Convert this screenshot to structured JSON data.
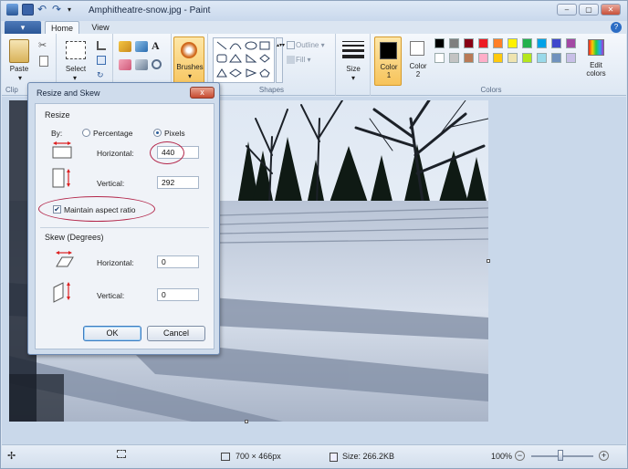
{
  "window": {
    "title": "Amphitheatre-snow.jpg - Paint",
    "help_label": "?"
  },
  "tabs": {
    "file_label": "▾",
    "home_label": "Home",
    "view_label": "View"
  },
  "ribbon": {
    "clipboard": {
      "paste_label": "Paste",
      "group_label": "Clip"
    },
    "image": {
      "select_label": "Select"
    },
    "tools": {
      "brushes_label": "Brushes"
    },
    "shapes": {
      "outline_label": "Outline ▾",
      "fill_label": "Fill ▾",
      "group_label": "Shapes"
    },
    "size": {
      "label": "Size"
    },
    "colors": {
      "color1_label": "Color\n1",
      "color2_label": "Color\n2",
      "edit_label": "Edit\ncolors",
      "group_label": "Colors",
      "color1_value": "#000000",
      "color2_value": "#ffffff",
      "palette_row1": [
        "#000000",
        "#7f7f7f",
        "#880015",
        "#ed1c24",
        "#ff7f27",
        "#fff200",
        "#22b14c",
        "#00a2e8",
        "#3f48cc",
        "#a349a4"
      ],
      "palette_row2": [
        "#ffffff",
        "#c3c3c3",
        "#b97a57",
        "#ffaec9",
        "#ffc90e",
        "#efe4b0",
        "#b5e61d",
        "#99d9ea",
        "#7092be",
        "#c8bfe7"
      ]
    }
  },
  "dialog": {
    "title": "Resize and Skew",
    "close_label": "x",
    "resize": {
      "heading": "Resize",
      "by_label": "By:",
      "percentage_label": "Percentage",
      "pixels_label": "Pixels",
      "selected_unit": "Pixels",
      "horizontal_label": "Horizontal:",
      "horizontal_value": "440",
      "vertical_label": "Vertical:",
      "vertical_value": "292",
      "aspect_label": "Maintain aspect ratio",
      "aspect_checked": true
    },
    "skew": {
      "heading": "Skew (Degrees)",
      "horizontal_label": "Horizontal:",
      "horizontal_value": "0",
      "vertical_label": "Vertical:",
      "vertical_value": "0"
    },
    "ok_label": "OK",
    "cancel_label": "Cancel"
  },
  "status": {
    "dimensions": "700 × 466px",
    "size": "Size: 266.2KB",
    "zoom": "100%"
  },
  "colors": {
    "highlight_oval": "#b3264a",
    "accent": "#2b5797"
  }
}
